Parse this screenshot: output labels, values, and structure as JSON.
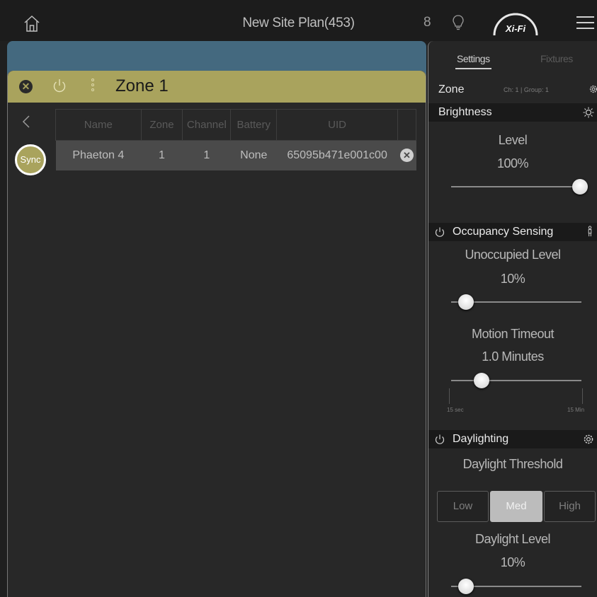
{
  "topbar": {
    "title": "New Site Plan(453)",
    "user_count": "8",
    "logo_text": "Xi-Fi",
    "icons": [
      "home-icon",
      "bulb-icon",
      "menu-icon"
    ]
  },
  "zone_panel": {
    "title": "Zone 1",
    "sync_label": "Sync",
    "icons": [
      "close-icon",
      "power-icon",
      "more-icon",
      "back-icon"
    ],
    "table": {
      "headers": [
        "Name",
        "Zone",
        "Channel",
        "Battery",
        "UID",
        ""
      ],
      "rows": [
        {
          "name": "Phaeton 4",
          "zone": "1",
          "channel": "1",
          "battery": "None",
          "uid": "65095b471e001c00"
        }
      ]
    }
  },
  "settings": {
    "tabs": {
      "settings": "Settings",
      "fixtures": "Fixtures"
    },
    "zone": {
      "label": "Zone",
      "info": "Ch: 1 | Group: 1"
    },
    "brightness": {
      "header": "Brightness",
      "level_label": "Level",
      "level_value": "100%",
      "level_fraction": 1.0
    },
    "occupancy": {
      "header": "Occupancy Sensing",
      "unoccupied_label": "Unoccupied Level",
      "unoccupied_value": "10%",
      "unoccupied_fraction": 0.1,
      "timeout_label": "Motion Timeout",
      "timeout_value": "1.0 Minutes",
      "timeout_fraction": 0.25,
      "timeout_min": "15 sec",
      "timeout_max": "15 Min"
    },
    "daylighting": {
      "header": "Daylighting",
      "threshold_label": "Daylight Threshold",
      "options": [
        "Low",
        "Med",
        "High"
      ],
      "selected": "Med",
      "level_label": "Daylight Level",
      "level_value": "10%",
      "level_fraction": 0.1
    }
  },
  "colors": {
    "accent": "#a9a35d",
    "panel_blue": "#44697f",
    "background": "#1f1f1f"
  }
}
